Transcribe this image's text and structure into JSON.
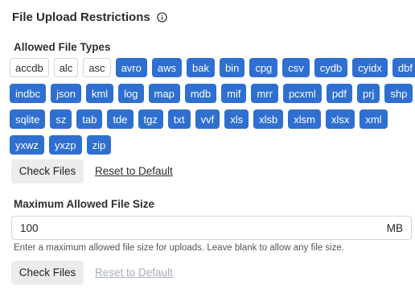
{
  "title": "File Upload Restrictions",
  "allowed_types": {
    "label": "Allowed File Types",
    "rows": [
      [
        {
          "t": "accdb",
          "on": false
        },
        {
          "t": "alc",
          "on": false
        },
        {
          "t": "asc",
          "on": false
        },
        {
          "t": "avro",
          "on": true
        },
        {
          "t": "aws",
          "on": true
        },
        {
          "t": "bak",
          "on": true
        },
        {
          "t": "bin",
          "on": true
        },
        {
          "t": "cpg",
          "on": true
        },
        {
          "t": "csv",
          "on": true
        },
        {
          "t": "cydb",
          "on": true
        },
        {
          "t": "cyidx",
          "on": true
        },
        {
          "t": "dbf",
          "on": true
        }
      ],
      [
        {
          "t": "indbc",
          "on": true
        },
        {
          "t": "json",
          "on": true
        },
        {
          "t": "kml",
          "on": true
        },
        {
          "t": "log",
          "on": true
        },
        {
          "t": "map",
          "on": true
        },
        {
          "t": "mdb",
          "on": true
        },
        {
          "t": "mif",
          "on": true
        },
        {
          "t": "mrr",
          "on": true
        },
        {
          "t": "pcxml",
          "on": true
        },
        {
          "t": "pdf",
          "on": true
        },
        {
          "t": "prj",
          "on": true
        },
        {
          "t": "shp",
          "on": true
        }
      ],
      [
        {
          "t": "sqlite",
          "on": true
        },
        {
          "t": "sz",
          "on": true
        },
        {
          "t": "tab",
          "on": true
        },
        {
          "t": "tde",
          "on": true
        },
        {
          "t": "tgz",
          "on": true
        },
        {
          "t": "txt",
          "on": true
        },
        {
          "t": "vvf",
          "on": true
        },
        {
          "t": "xls",
          "on": true
        },
        {
          "t": "xlsb",
          "on": true
        },
        {
          "t": "xlsm",
          "on": true
        },
        {
          "t": "xlsx",
          "on": true
        },
        {
          "t": "xml",
          "on": true
        }
      ],
      [
        {
          "t": "yxwz",
          "on": true
        },
        {
          "t": "yxzp",
          "on": true
        },
        {
          "t": "zip",
          "on": true
        }
      ]
    ],
    "check_label": "Check Files",
    "reset_label": "Reset to Default"
  },
  "max_size": {
    "label": "Maximum Allowed File Size",
    "value": "100",
    "unit": "MB",
    "help": "Enter a maximum allowed file size for uploads. Leave blank to allow any file size.",
    "check_label": "Check Files",
    "reset_label": "Reset to Default"
  },
  "colors": {
    "chip_on": "#2f6fd0",
    "chip_off_border": "#cfd5dc"
  }
}
